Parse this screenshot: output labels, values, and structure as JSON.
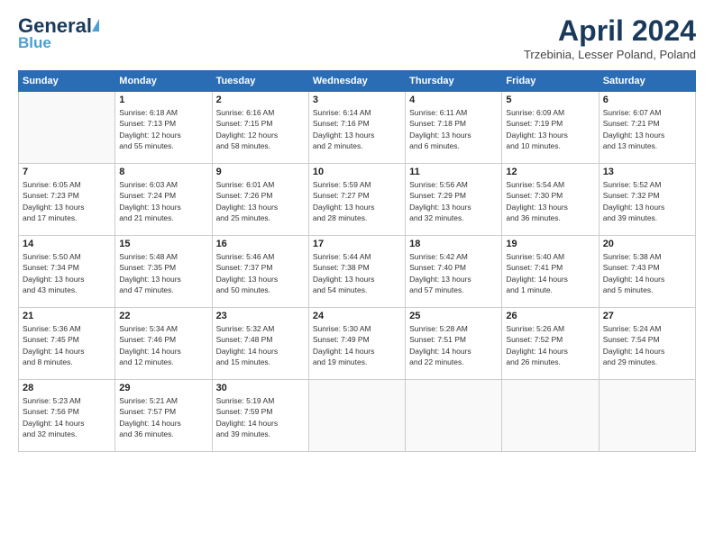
{
  "header": {
    "logo_general": "General",
    "logo_blue": "Blue",
    "title": "April 2024",
    "subtitle": "Trzebinia, Lesser Poland, Poland"
  },
  "days_of_week": [
    "Sunday",
    "Monday",
    "Tuesday",
    "Wednesday",
    "Thursday",
    "Friday",
    "Saturday"
  ],
  "weeks": [
    [
      {
        "day": "",
        "info": ""
      },
      {
        "day": "1",
        "info": "Sunrise: 6:18 AM\nSunset: 7:13 PM\nDaylight: 12 hours\nand 55 minutes."
      },
      {
        "day": "2",
        "info": "Sunrise: 6:16 AM\nSunset: 7:15 PM\nDaylight: 12 hours\nand 58 minutes."
      },
      {
        "day": "3",
        "info": "Sunrise: 6:14 AM\nSunset: 7:16 PM\nDaylight: 13 hours\nand 2 minutes."
      },
      {
        "day": "4",
        "info": "Sunrise: 6:11 AM\nSunset: 7:18 PM\nDaylight: 13 hours\nand 6 minutes."
      },
      {
        "day": "5",
        "info": "Sunrise: 6:09 AM\nSunset: 7:19 PM\nDaylight: 13 hours\nand 10 minutes."
      },
      {
        "day": "6",
        "info": "Sunrise: 6:07 AM\nSunset: 7:21 PM\nDaylight: 13 hours\nand 13 minutes."
      }
    ],
    [
      {
        "day": "7",
        "info": "Sunrise: 6:05 AM\nSunset: 7:23 PM\nDaylight: 13 hours\nand 17 minutes."
      },
      {
        "day": "8",
        "info": "Sunrise: 6:03 AM\nSunset: 7:24 PM\nDaylight: 13 hours\nand 21 minutes."
      },
      {
        "day": "9",
        "info": "Sunrise: 6:01 AM\nSunset: 7:26 PM\nDaylight: 13 hours\nand 25 minutes."
      },
      {
        "day": "10",
        "info": "Sunrise: 5:59 AM\nSunset: 7:27 PM\nDaylight: 13 hours\nand 28 minutes."
      },
      {
        "day": "11",
        "info": "Sunrise: 5:56 AM\nSunset: 7:29 PM\nDaylight: 13 hours\nand 32 minutes."
      },
      {
        "day": "12",
        "info": "Sunrise: 5:54 AM\nSunset: 7:30 PM\nDaylight: 13 hours\nand 36 minutes."
      },
      {
        "day": "13",
        "info": "Sunrise: 5:52 AM\nSunset: 7:32 PM\nDaylight: 13 hours\nand 39 minutes."
      }
    ],
    [
      {
        "day": "14",
        "info": "Sunrise: 5:50 AM\nSunset: 7:34 PM\nDaylight: 13 hours\nand 43 minutes."
      },
      {
        "day": "15",
        "info": "Sunrise: 5:48 AM\nSunset: 7:35 PM\nDaylight: 13 hours\nand 47 minutes."
      },
      {
        "day": "16",
        "info": "Sunrise: 5:46 AM\nSunset: 7:37 PM\nDaylight: 13 hours\nand 50 minutes."
      },
      {
        "day": "17",
        "info": "Sunrise: 5:44 AM\nSunset: 7:38 PM\nDaylight: 13 hours\nand 54 minutes."
      },
      {
        "day": "18",
        "info": "Sunrise: 5:42 AM\nSunset: 7:40 PM\nDaylight: 13 hours\nand 57 minutes."
      },
      {
        "day": "19",
        "info": "Sunrise: 5:40 AM\nSunset: 7:41 PM\nDaylight: 14 hours\nand 1 minute."
      },
      {
        "day": "20",
        "info": "Sunrise: 5:38 AM\nSunset: 7:43 PM\nDaylight: 14 hours\nand 5 minutes."
      }
    ],
    [
      {
        "day": "21",
        "info": "Sunrise: 5:36 AM\nSunset: 7:45 PM\nDaylight: 14 hours\nand 8 minutes."
      },
      {
        "day": "22",
        "info": "Sunrise: 5:34 AM\nSunset: 7:46 PM\nDaylight: 14 hours\nand 12 minutes."
      },
      {
        "day": "23",
        "info": "Sunrise: 5:32 AM\nSunset: 7:48 PM\nDaylight: 14 hours\nand 15 minutes."
      },
      {
        "day": "24",
        "info": "Sunrise: 5:30 AM\nSunset: 7:49 PM\nDaylight: 14 hours\nand 19 minutes."
      },
      {
        "day": "25",
        "info": "Sunrise: 5:28 AM\nSunset: 7:51 PM\nDaylight: 14 hours\nand 22 minutes."
      },
      {
        "day": "26",
        "info": "Sunrise: 5:26 AM\nSunset: 7:52 PM\nDaylight: 14 hours\nand 26 minutes."
      },
      {
        "day": "27",
        "info": "Sunrise: 5:24 AM\nSunset: 7:54 PM\nDaylight: 14 hours\nand 29 minutes."
      }
    ],
    [
      {
        "day": "28",
        "info": "Sunrise: 5:23 AM\nSunset: 7:56 PM\nDaylight: 14 hours\nand 32 minutes."
      },
      {
        "day": "29",
        "info": "Sunrise: 5:21 AM\nSunset: 7:57 PM\nDaylight: 14 hours\nand 36 minutes."
      },
      {
        "day": "30",
        "info": "Sunrise: 5:19 AM\nSunset: 7:59 PM\nDaylight: 14 hours\nand 39 minutes."
      },
      {
        "day": "",
        "info": ""
      },
      {
        "day": "",
        "info": ""
      },
      {
        "day": "",
        "info": ""
      },
      {
        "day": "",
        "info": ""
      }
    ]
  ]
}
